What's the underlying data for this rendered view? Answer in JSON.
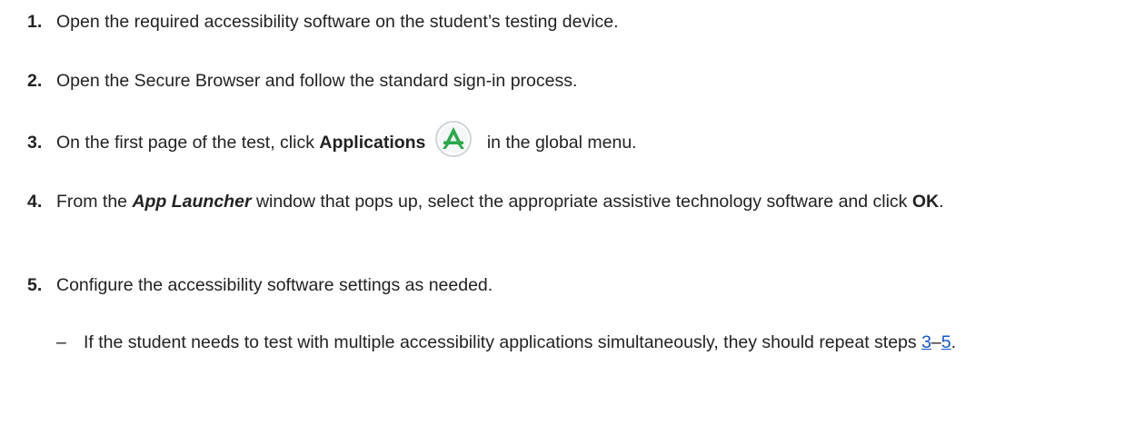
{
  "steps": [
    {
      "number": "1.",
      "text": "Open the required accessibility software on the student’s testing device."
    },
    {
      "number": "2.",
      "text": "Open the Secure Browser and follow the standard sign-in process."
    },
    {
      "number": "3.",
      "text_before": "On the first page of the test, click ",
      "bold": "Applications",
      "icon": "app-launcher-icon",
      "text_after": " in the global menu."
    },
    {
      "number": "4.",
      "text_before": "From the ",
      "bold_italic": "App Launcher",
      "text_middle": " window that pops up, select the appropriate assistive technology software and click ",
      "bold": "OK",
      "text_after": "."
    },
    {
      "number": "5.",
      "text": "Configure the accessibility software settings as needed."
    }
  ],
  "substep": {
    "dash": "–",
    "text_before": "If the student needs to test with multiple accessibility applications simultaneously, they should repeat steps ",
    "link_start": "3",
    "range_sep": "–",
    "link_end": "5",
    "text_after": "."
  },
  "colors": {
    "text": "#222222",
    "link": "#1155cc",
    "icon_green": "#2aa84a"
  }
}
